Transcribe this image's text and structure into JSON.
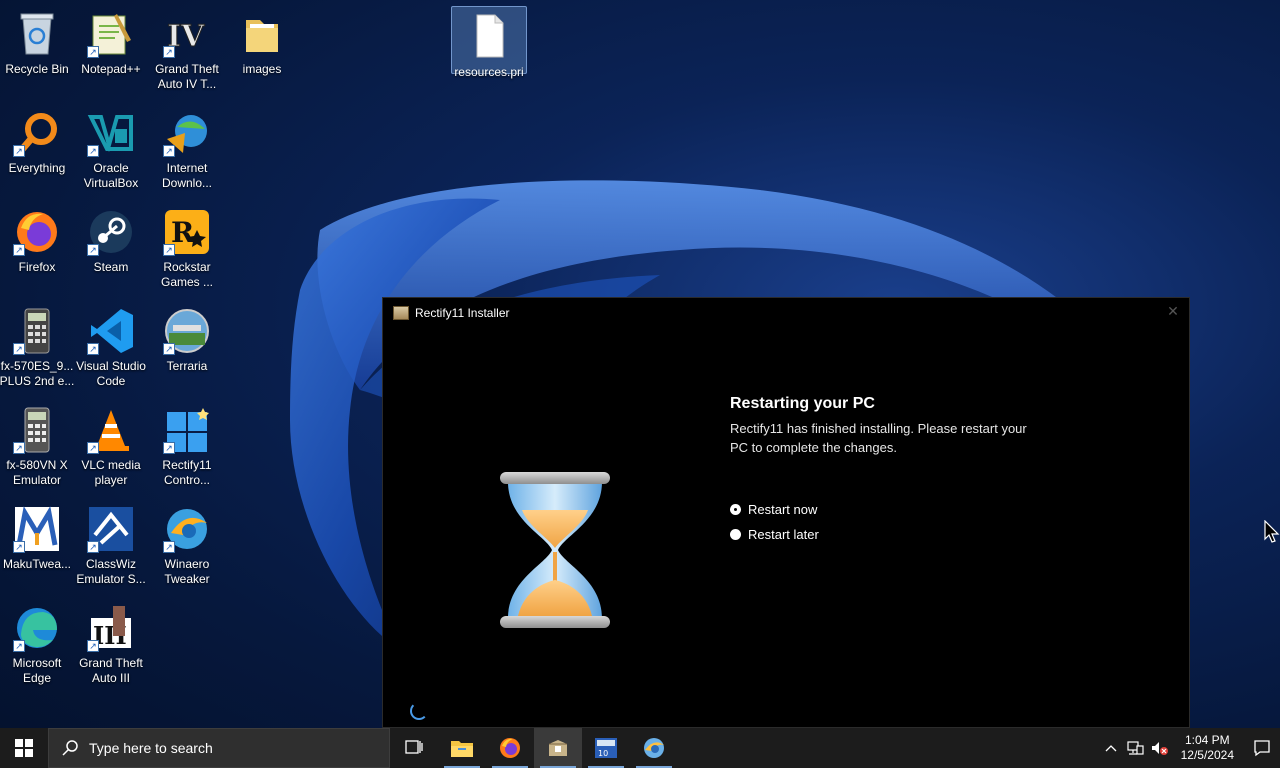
{
  "desktop": {
    "icons": [
      {
        "label": "Recycle Bin"
      },
      {
        "label": "Notepad++"
      },
      {
        "label": "Grand Theft Auto IV T..."
      },
      {
        "label": "images"
      },
      {
        "label": "resources.pri"
      },
      {
        "label": "Everything"
      },
      {
        "label": "Oracle VirtualBox"
      },
      {
        "label": "Internet Downlo..."
      },
      {
        "label": "Firefox"
      },
      {
        "label": "Steam"
      },
      {
        "label": "Rockstar Games ..."
      },
      {
        "label": "fx-570ES_9... PLUS 2nd e..."
      },
      {
        "label": "Visual Studio Code"
      },
      {
        "label": "Terraria"
      },
      {
        "label": "fx-580VN X Emulator"
      },
      {
        "label": "VLC media player"
      },
      {
        "label": "Rectify11 Contro..."
      },
      {
        "label": "MakuTwea..."
      },
      {
        "label": "ClassWiz Emulator S..."
      },
      {
        "label": "Winaero Tweaker"
      },
      {
        "label": "Microsoft Edge"
      },
      {
        "label": "Grand Theft Auto III"
      }
    ]
  },
  "installer": {
    "title": "Rectify11 Installer",
    "heading": "Restarting your PC",
    "description": "Rectify11 has finished installing. Please restart your PC to complete the changes.",
    "options": [
      {
        "label": "Restart now",
        "selected": true
      },
      {
        "label": "Restart later",
        "selected": false
      }
    ]
  },
  "taskbar": {
    "search_placeholder": "Type here to search",
    "time": "1:04 PM",
    "date": "12/5/2024"
  },
  "colors": {
    "accent": "#4a9be8",
    "taskbar": "#1c1c1c",
    "window_bg": "#000000"
  }
}
